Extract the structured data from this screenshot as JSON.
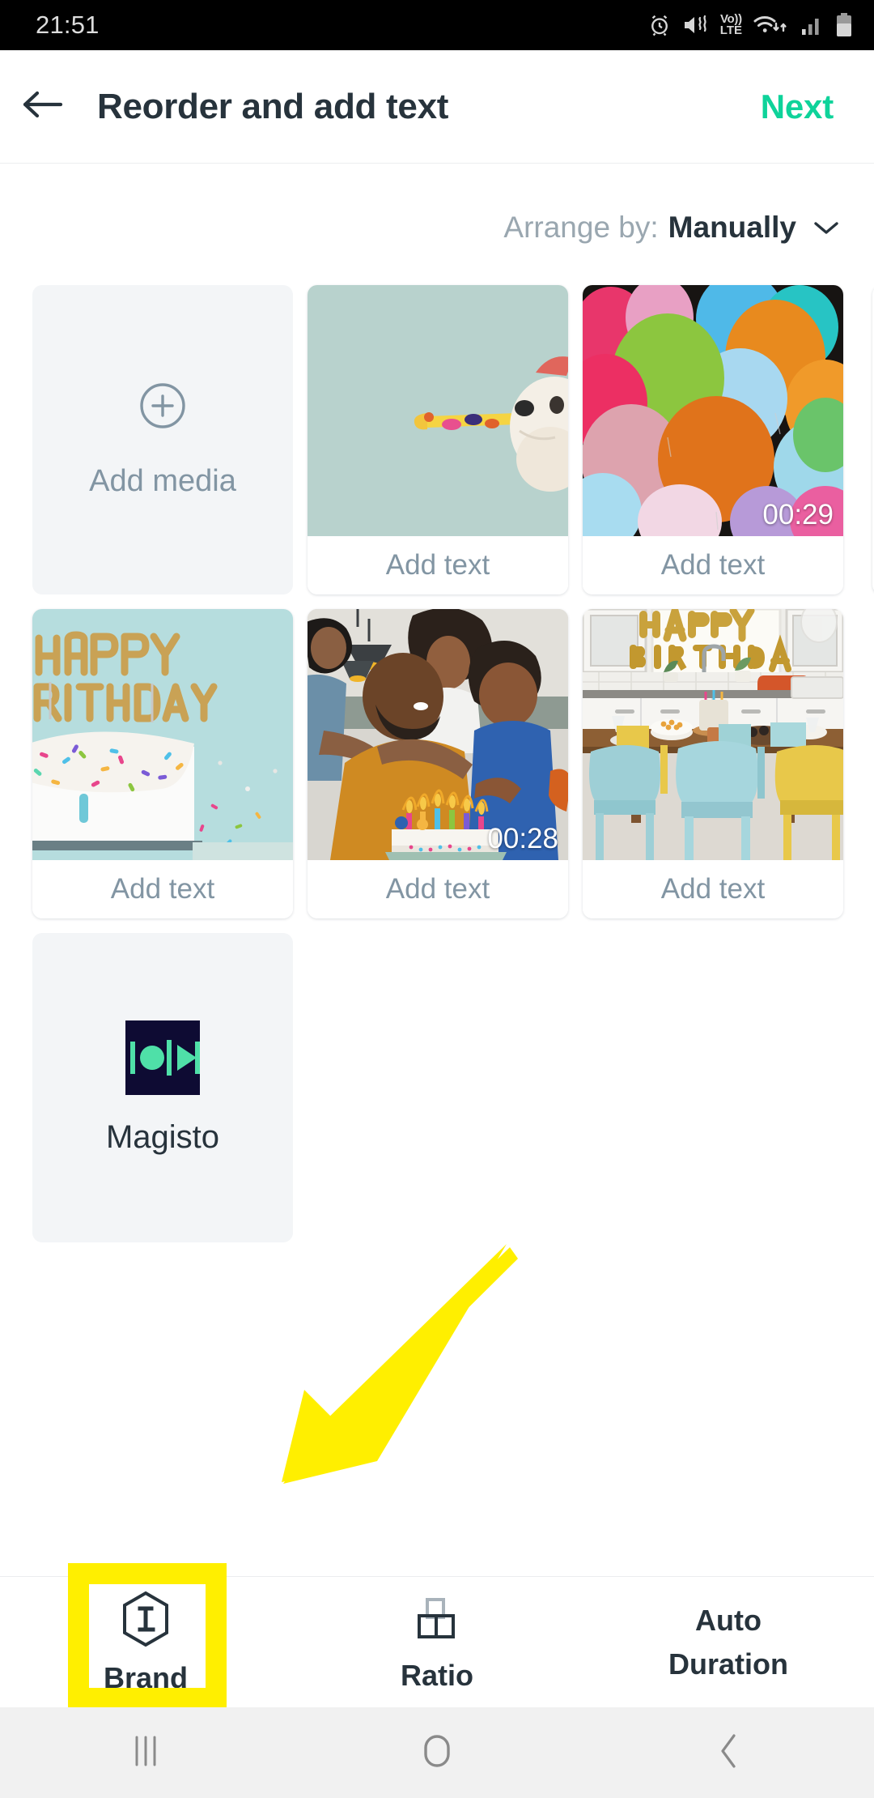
{
  "status_bar": {
    "time": "21:51",
    "icons": [
      "alarm-icon",
      "mute-vibrate-icon",
      "volte-icon",
      "wifi-icon",
      "signal-icon",
      "battery-icon"
    ],
    "volte_top": "Vo))",
    "volte_bottom": "LTE"
  },
  "header": {
    "back_icon": "arrow-left-icon",
    "title": "Reorder and add text",
    "next_label": "Next",
    "next_color": "#0ed39a"
  },
  "arrange": {
    "label": "Arrange by:",
    "value": "Manually",
    "caret_icon": "chevron-down-icon"
  },
  "media_tiles": [
    {
      "type": "add-media",
      "label": "Add media",
      "icon": "plus-circle-icon"
    },
    {
      "type": "media",
      "caption": "Add text",
      "duration": "",
      "description": "dog-with-party-blower"
    },
    {
      "type": "media",
      "caption": "Add text",
      "duration": "00:29",
      "description": "colorful-balloons"
    },
    {
      "type": "media",
      "caption": "Add text",
      "duration": "",
      "description": "happy-birthday-cake"
    },
    {
      "type": "media",
      "caption": "Add text",
      "duration": "00:28",
      "description": "family-with-birthday-cake"
    },
    {
      "type": "media",
      "caption": "Add text",
      "duration": "",
      "description": "kitchen-birthday-balloons"
    },
    {
      "type": "app",
      "label": "Magisto",
      "icon": "magisto-logo",
      "logo_bg": "#0e0b33",
      "logo_accent": "#4fe0a8"
    }
  ],
  "toolbar": {
    "items": [
      {
        "label": "Brand",
        "top_label": "",
        "icon": "brand-hexagon-l-icon",
        "highlighted": true
      },
      {
        "label": "Ratio",
        "top_label": "",
        "icon": "ratio-icon",
        "highlighted": false
      },
      {
        "label": "Duration",
        "top_label": "Auto",
        "icon": "",
        "highlighted": false
      }
    ],
    "highlight_color": "#ffef00"
  },
  "annotation": {
    "arrow_color": "#ffef00",
    "arrow_direction": "down-left",
    "points_to": "Brand"
  },
  "nav_bar": {
    "recents_icon": "recents-icon",
    "home_icon": "home-icon",
    "back_icon": "back-chevron-icon"
  }
}
